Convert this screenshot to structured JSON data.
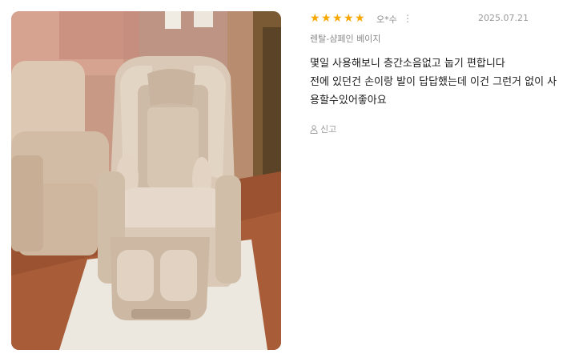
{
  "review": {
    "rating": 5,
    "rating_max": 5,
    "star_color": "#f6a700",
    "star_glyph": "★",
    "user": "오*수",
    "more_icon": "⋮",
    "date": "2025.07.21",
    "option": "렌탈-샴페인 베이지",
    "body_lines": [
      "몇일 사용해보니 층간소음없고 눕기 편합니다",
      "전에 있던건 손이랑 발이 답답했는데 이건 그런거 없이 사",
      "용할수있어좋아요"
    ],
    "report_label": "신고"
  },
  "icons": {
    "report": "person-report-icon",
    "more": "vertical-dots-icon"
  }
}
